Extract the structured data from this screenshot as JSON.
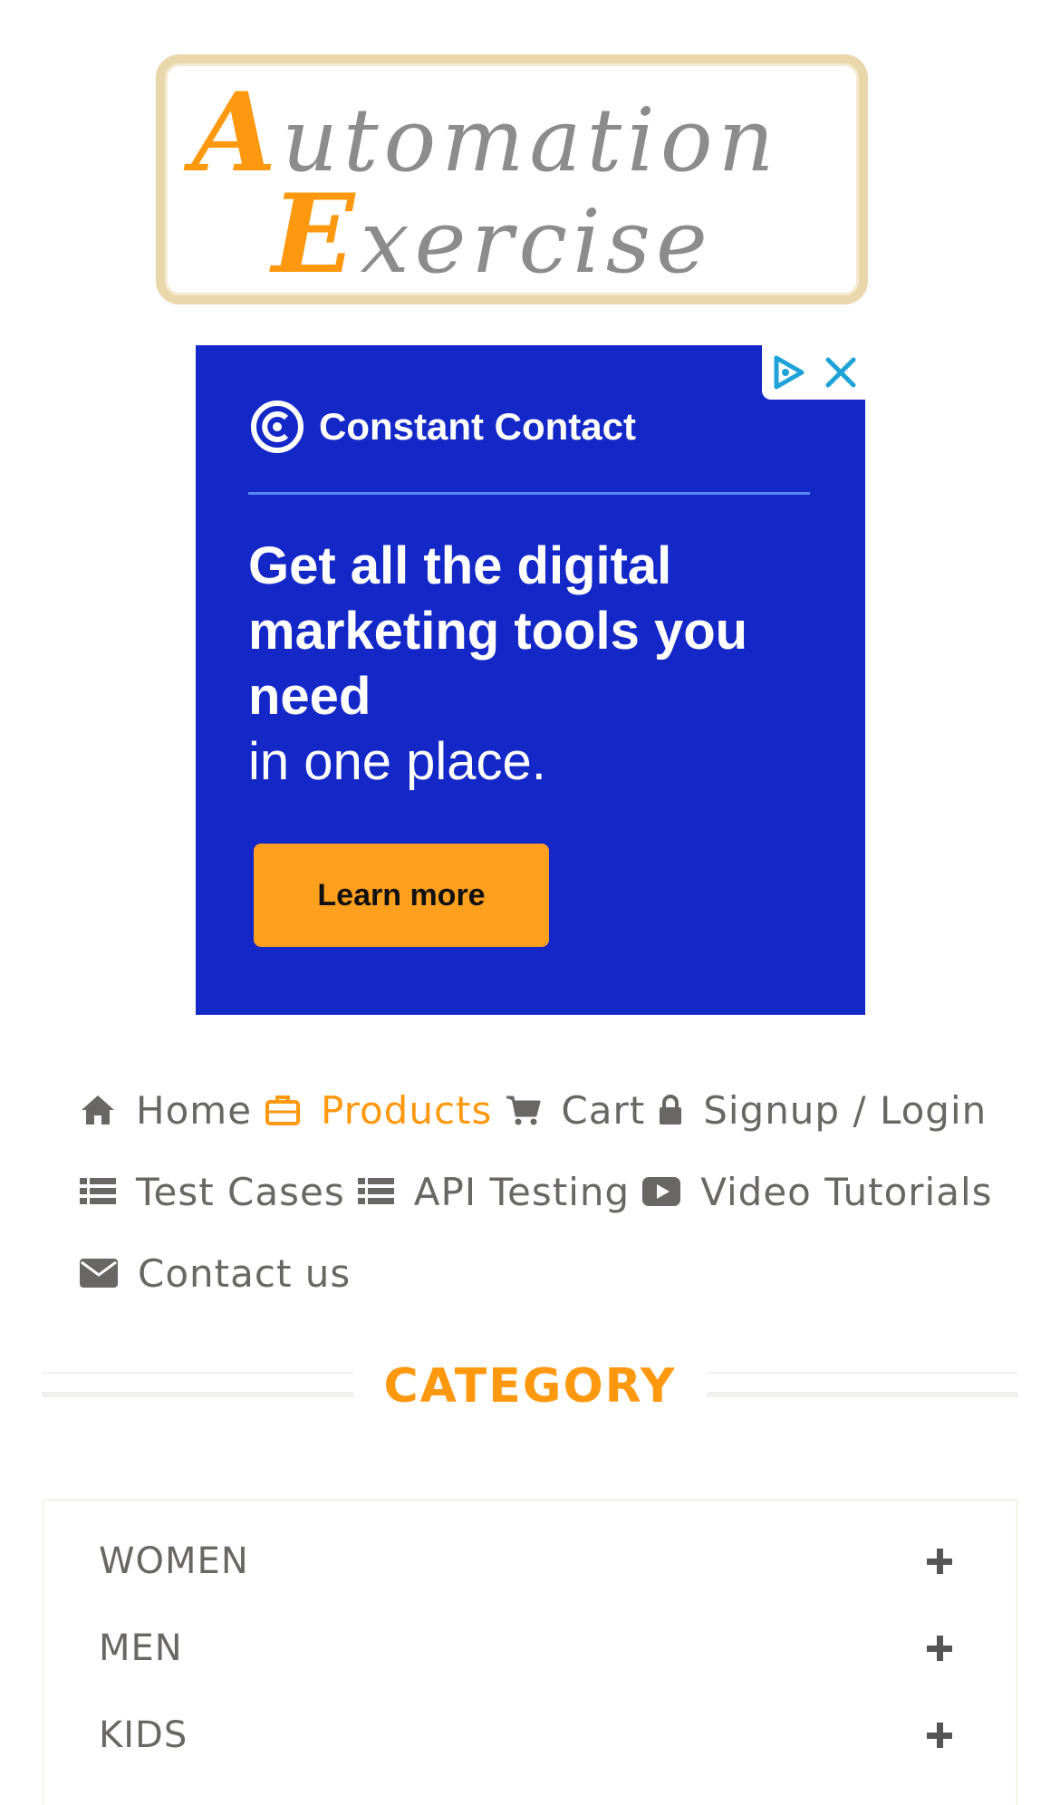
{
  "logo": {
    "line1_first": "A",
    "line1_rest": "utomation",
    "line2_first": "E",
    "line2_rest": "xercise"
  },
  "ad": {
    "brand": "Constant Contact",
    "headline_bold": "Get all the digital marketing tools you need",
    "headline_light": "in one place.",
    "cta": "Learn more",
    "colors": {
      "background": "#1428c8",
      "cta": "#ffa01e"
    }
  },
  "nav": {
    "items": [
      {
        "label": "Home",
        "icon": "home-icon"
      },
      {
        "label": "Products",
        "icon": "briefcase-icon",
        "active": true
      },
      {
        "label": "Cart",
        "icon": "shopping-cart-icon"
      },
      {
        "label": "Signup / Login",
        "icon": "lock-icon"
      },
      {
        "label": "Test Cases",
        "icon": "list-icon"
      },
      {
        "label": "API Testing",
        "icon": "list-icon"
      },
      {
        "label": "Video Tutorials",
        "icon": "youtube-play-icon"
      },
      {
        "label": "Contact us",
        "icon": "envelope-icon"
      }
    ],
    "colors": {
      "active": "#fe980f",
      "default": "#696763"
    }
  },
  "category": {
    "title": "CATEGORY",
    "items": [
      {
        "label": "WOMEN"
      },
      {
        "label": "MEN"
      },
      {
        "label": "KIDS"
      }
    ]
  }
}
